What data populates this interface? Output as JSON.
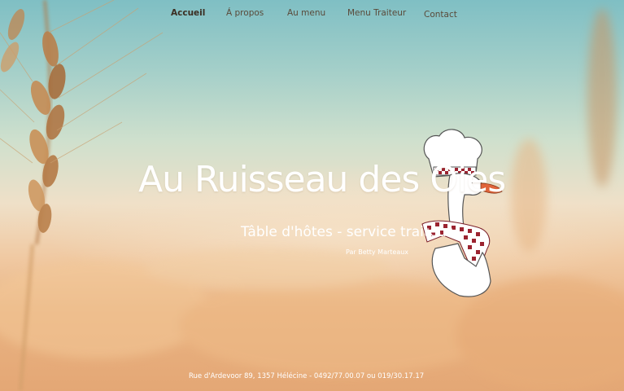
{
  "nav": {
    "items": [
      {
        "label": "Accueil",
        "active": true
      },
      {
        "label": "Á propos",
        "active": false
      },
      {
        "label": "Au menu",
        "active": false
      },
      {
        "label": "Menu Traiteur",
        "active": false
      },
      {
        "label": "Contact",
        "active": false
      }
    ]
  },
  "hero": {
    "title": "Au Ruisseau des Oies",
    "subtitle": "Tâble d'hôtes - service traiteur",
    "byline": "Par Betty Marteaux"
  },
  "footer": {
    "contact": "Rue d'Ardevoor 89, 1357 Hélécine  - 0492/77.00.07 ou 019/30.17.17"
  },
  "images": {
    "background": "wheat-field-photo",
    "mascot": "goose-chef-illustration"
  },
  "colors": {
    "nav_text": "#5a4a3a",
    "hero_text": "#ffffff"
  }
}
